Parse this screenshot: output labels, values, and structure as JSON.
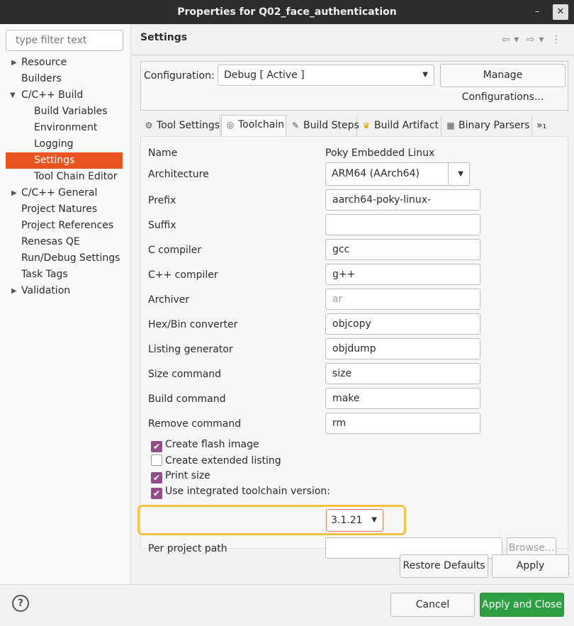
{
  "window": {
    "title": "Properties for Q02_face_authentication",
    "minimize": "–",
    "close": "✕"
  },
  "sidebar": {
    "filter_placeholder": "type filter text",
    "items": [
      {
        "label": "Resource"
      },
      {
        "label": "Builders"
      },
      {
        "label": "C/C++ Build"
      },
      {
        "label": "Build Variables"
      },
      {
        "label": "Environment"
      },
      {
        "label": "Logging"
      },
      {
        "label": "Settings"
      },
      {
        "label": "Tool Chain Editor"
      },
      {
        "label": "C/C++ General"
      },
      {
        "label": "Project Natures"
      },
      {
        "label": "Project References"
      },
      {
        "label": "Renesas QE"
      },
      {
        "label": "Run/Debug Settings"
      },
      {
        "label": "Task Tags"
      },
      {
        "label": "Validation"
      }
    ],
    "selected": "Settings"
  },
  "page": {
    "title": "Settings"
  },
  "configuration": {
    "label": "Configuration:",
    "value": "Debug  [ Active ]",
    "manage_button": "Manage Configurations..."
  },
  "tabs": [
    {
      "label": "Tool Settings",
      "icon": "tool-settings-icon"
    },
    {
      "label": "Toolchain",
      "icon": "toolchain-icon"
    },
    {
      "label": "Build Steps",
      "icon": "build-steps-icon"
    },
    {
      "label": "Build Artifact",
      "icon": "trophy-icon"
    },
    {
      "label": "Binary Parsers",
      "icon": "binary-icon"
    },
    {
      "label": "»₁",
      "icon": "more-tabs-icon"
    }
  ],
  "active_tab": "Toolchain",
  "toolchain": {
    "name_label": "Name",
    "name_value": "Poky Embedded Linux",
    "architecture_label": "Architecture",
    "architecture_value": "ARM64 (AArch64)",
    "fields": [
      {
        "label": "Prefix",
        "value": "aarch64-poky-linux-"
      },
      {
        "label": "Suffix",
        "value": ""
      },
      {
        "label": "C compiler",
        "value": "gcc"
      },
      {
        "label": "C++ compiler",
        "value": "g++"
      },
      {
        "label": "Archiver",
        "value": "ar"
      },
      {
        "label": "Hex/Bin converter",
        "value": "objcopy"
      },
      {
        "label": "Listing generator",
        "value": "objdump"
      },
      {
        "label": "Size command",
        "value": "size"
      },
      {
        "label": "Build command",
        "value": "make"
      },
      {
        "label": "Remove command",
        "value": "rm"
      }
    ],
    "checkboxes": [
      {
        "label": "Create flash image",
        "checked": true
      },
      {
        "label": "Create extended listing",
        "checked": false
      },
      {
        "label": "Print size",
        "checked": true
      },
      {
        "label": "Use integrated toolchain version:",
        "checked": true
      }
    ],
    "toolchain_version": "3.1.21",
    "per_project_label": "Per project path",
    "per_project_value": "",
    "browse_button": "Browse..."
  },
  "buttons": {
    "restore_defaults": "Restore Defaults",
    "apply": "Apply",
    "cancel": "Cancel",
    "apply_close": "Apply and Close"
  },
  "colors": {
    "selection": "#e95420",
    "checkbox": "#924d8b",
    "highlight": "#f5c242",
    "primary": "#2ea043"
  }
}
